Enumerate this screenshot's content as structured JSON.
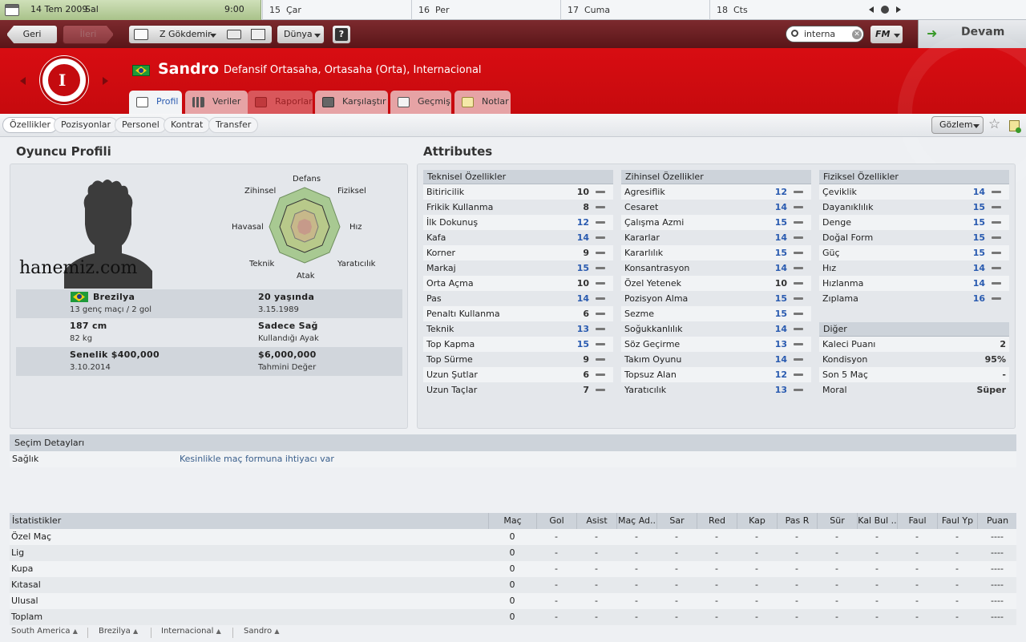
{
  "calendar": {
    "today_date": "14 Tem 2009",
    "today_day": "Sal",
    "time": "9:00",
    "days": [
      {
        "num": "15",
        "name": "Çar"
      },
      {
        "num": "16",
        "name": "Per"
      },
      {
        "num": "17",
        "name": "Cuma"
      },
      {
        "num": "18",
        "name": "Cts"
      }
    ]
  },
  "nav": {
    "back": "Geri",
    "forward": "İleri",
    "manager": "Z Gökdemir",
    "world": "Dünya",
    "help": "?",
    "search_value": "interna",
    "fm": "FM",
    "continue": "Devam"
  },
  "player": {
    "name": "Sandro",
    "positions": "Defansif Ortasaha, Ortasaha (Orta), Internacional"
  },
  "tabs": [
    "Profil",
    "Veriler",
    "Raporlar",
    "Karşılaştır",
    "Geçmiş",
    "Notlar"
  ],
  "subtabs": [
    "Özellikler",
    "Pozisyonlar",
    "Personel",
    "Kontrat",
    "Transfer"
  ],
  "view_button": "Gözlem",
  "profile": {
    "title": "Oyuncu Profili",
    "watermark": "hanemiz.com",
    "radar": {
      "top": "Defans",
      "top_right": "Fiziksel",
      "right": "Hız",
      "bottom_right": "Yaratıcılık",
      "bottom": "Atak",
      "bottom_left": "Teknik",
      "left": "Havasal",
      "top_left": "Zihinsel"
    },
    "nation": "Brezilya",
    "caps": "13 genç maçı / 2 gol",
    "age": "20 yaşında",
    "dob": "3.15.1989",
    "height": "187 cm",
    "weight": "82 kg",
    "foot": "Sadece Sağ",
    "foot_label": "Kullandığı Ayak",
    "wage": "Senelik $400,000",
    "contract_end": "3.10.2014",
    "value": "$6,000,000",
    "value_label": "Tahmini Değer"
  },
  "attributes": {
    "title": "Attributes",
    "technical": {
      "header": "Teknisel Özellikler",
      "items": [
        {
          "name": "Bitiricilik",
          "value": "10"
        },
        {
          "name": "Frikik Kullanma",
          "value": "8"
        },
        {
          "name": "İlk Dokunuş",
          "value": "12"
        },
        {
          "name": "Kafa",
          "value": "14"
        },
        {
          "name": "Korner",
          "value": "9"
        },
        {
          "name": "Markaj",
          "value": "15"
        },
        {
          "name": "Orta Açma",
          "value": "10"
        },
        {
          "name": "Pas",
          "value": "14"
        },
        {
          "name": "Penaltı Kullanma",
          "value": "6"
        },
        {
          "name": "Teknik",
          "value": "13"
        },
        {
          "name": "Top Kapma",
          "value": "15"
        },
        {
          "name": "Top Sürme",
          "value": "9"
        },
        {
          "name": "Uzun Şutlar",
          "value": "6"
        },
        {
          "name": "Uzun Taçlar",
          "value": "7"
        }
      ]
    },
    "mental": {
      "header": "Zihinsel Özellikler",
      "items": [
        {
          "name": "Agresiflik",
          "value": "12"
        },
        {
          "name": "Cesaret",
          "value": "14"
        },
        {
          "name": "Çalışma Azmi",
          "value": "15"
        },
        {
          "name": "Kararlar",
          "value": "14"
        },
        {
          "name": "Kararlılık",
          "value": "15"
        },
        {
          "name": "Konsantrasyon",
          "value": "14"
        },
        {
          "name": "Özel Yetenek",
          "value": "10"
        },
        {
          "name": "Pozisyon Alma",
          "value": "15"
        },
        {
          "name": "Sezme",
          "value": "15"
        },
        {
          "name": "Soğukkanlılık",
          "value": "14"
        },
        {
          "name": "Söz Geçirme",
          "value": "13"
        },
        {
          "name": "Takım Oyunu",
          "value": "14"
        },
        {
          "name": "Topsuz Alan",
          "value": "12"
        },
        {
          "name": "Yaratıcılık",
          "value": "13"
        }
      ]
    },
    "physical": {
      "header": "Fiziksel Özellikler",
      "items": [
        {
          "name": "Çeviklik",
          "value": "14"
        },
        {
          "name": "Dayanıklılık",
          "value": "15"
        },
        {
          "name": "Denge",
          "value": "15"
        },
        {
          "name": "Doğal Form",
          "value": "15"
        },
        {
          "name": "Güç",
          "value": "15"
        },
        {
          "name": "Hız",
          "value": "14"
        },
        {
          "name": "Hızlanma",
          "value": "14"
        },
        {
          "name": "Zıplama",
          "value": "16"
        }
      ]
    },
    "other": {
      "header": "Diğer",
      "items": [
        {
          "name": "Kaleci Puanı",
          "value": "2"
        },
        {
          "name": "Kondisyon",
          "value": "95%"
        },
        {
          "name": "Son 5 Maç",
          "value": "-"
        },
        {
          "name": "Moral",
          "value": "Süper"
        }
      ]
    }
  },
  "selection": {
    "header": "Seçim Detayları",
    "label": "Sağlık",
    "value": "Kesinlikle maç formuna ihtiyacı var"
  },
  "stats": {
    "header": "İstatistikler",
    "columns": [
      "Maç",
      "Gol",
      "Asist",
      "Maç Ad..",
      "Sar",
      "Red",
      "Kap",
      "Pas R",
      "Sür",
      "Kal Bul ..",
      "Faul",
      "Faul Yp",
      "Puan"
    ],
    "rows": [
      {
        "name": "Özel Maç",
        "mac": "0"
      },
      {
        "name": "Lig",
        "mac": "0"
      },
      {
        "name": "Kupa",
        "mac": "0"
      },
      {
        "name": "Kıtasal",
        "mac": "0"
      },
      {
        "name": "Ulusal",
        "mac": "0"
      },
      {
        "name": "Toplam",
        "mac": "0"
      }
    ],
    "dash": "-",
    "rating_dash": "----"
  },
  "breadcrumbs": [
    "South America",
    "Brezilya",
    "Internacional",
    "Sandro"
  ],
  "colors": {
    "club_red": "#d20c11",
    "nav_dark": "#6b1f22",
    "blue_value": "#2a5bb0",
    "brazil_green": "#1e9a3a"
  }
}
